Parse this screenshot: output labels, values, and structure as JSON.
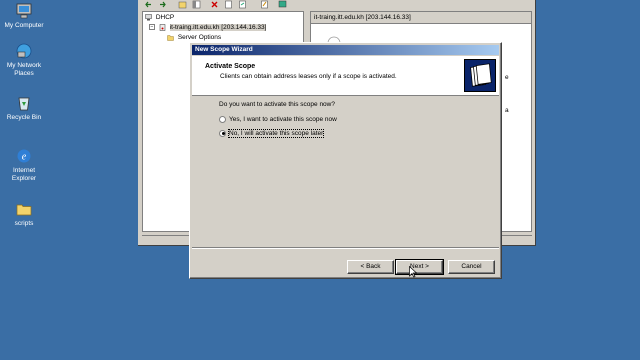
{
  "desktop": {
    "icons": [
      {
        "label": "My Computer",
        "icon": "my-computer-icon"
      },
      {
        "label": "My Network Places",
        "icon": "network-places-icon"
      },
      {
        "label": "Recycle Bin",
        "icon": "recycle-bin-icon"
      },
      {
        "label": "Internet Explorer",
        "icon": "internet-explorer-icon"
      },
      {
        "label": "scripts",
        "icon": "folder-icon"
      }
    ]
  },
  "mmc": {
    "tree": {
      "root": "DHCP",
      "server": "it-traing.itt.edu.kh [203.144.16.33]",
      "child": "Server Options"
    },
    "right_header": "it-traing.itt.edu.kh [203.144.16.33]",
    "right_snippets": [
      "e",
      "a"
    ]
  },
  "wizard": {
    "title": "New Scope Wizard",
    "header_title": "Activate Scope",
    "header_subtitle": "Clients can obtain address leases only if a scope is activated.",
    "question": "Do you want to activate this scope now?",
    "options": [
      {
        "label": "Yes, I want to activate this scope now",
        "checked": false
      },
      {
        "label": "No, I will activate this scope later",
        "checked": true
      }
    ],
    "buttons": {
      "back": "< Back",
      "next": "Next >",
      "cancel": "Cancel"
    }
  },
  "colors": {
    "desktop": "#3a6ea5",
    "titlebar_start": "#0a246a",
    "titlebar_end": "#a6caf0",
    "window_face": "#d4d0c8"
  }
}
